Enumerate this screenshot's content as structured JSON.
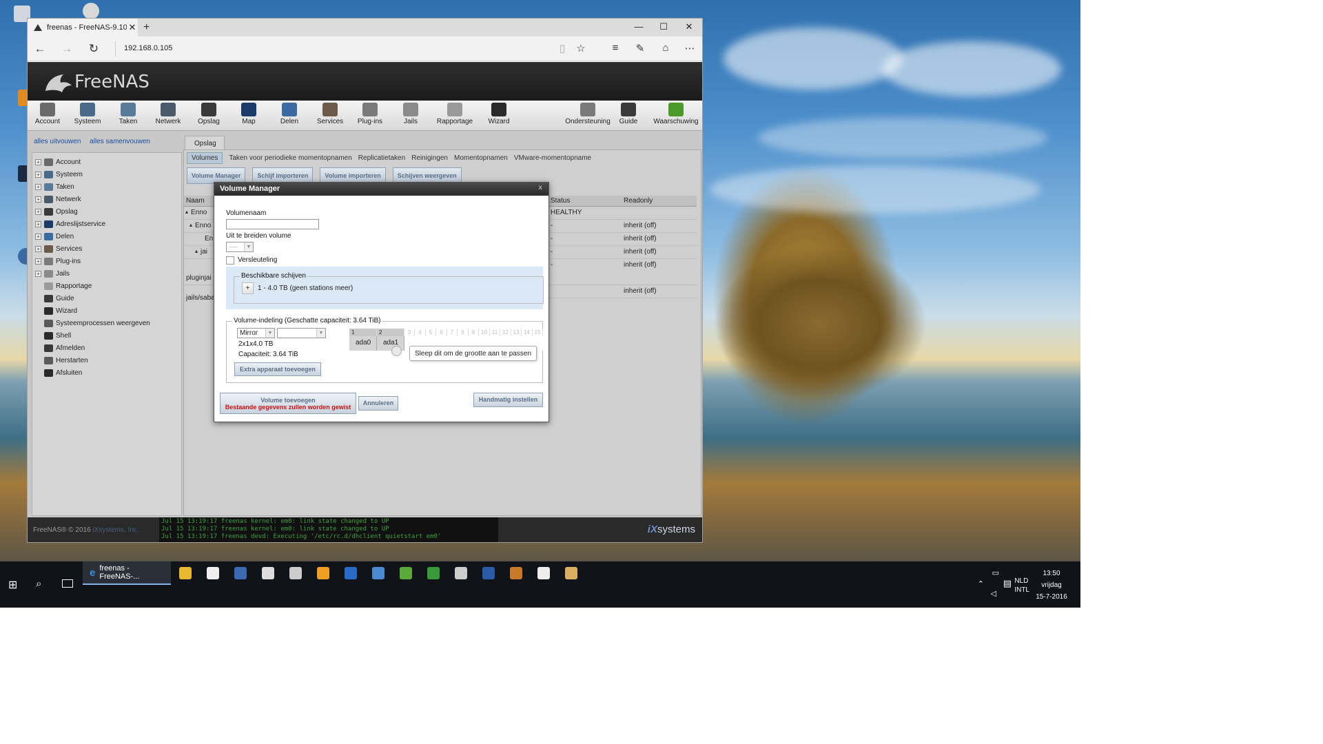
{
  "browser": {
    "tab_title": "freenas - FreeNAS-9.10-",
    "url": "192.168.0.105"
  },
  "freenas": {
    "logo": "FreeNAS",
    "toolbar": [
      {
        "label": "Account",
        "icon": "account-icon",
        "color": "#6a6a6a"
      },
      {
        "label": "Systeem",
        "icon": "system-icon",
        "color": "#4a6a8a"
      },
      {
        "label": "Taken",
        "icon": "tasks-icon",
        "color": "#5a7a9a"
      },
      {
        "label": "Netwerk",
        "icon": "network-icon",
        "color": "#4a5a6a"
      },
      {
        "label": "Opslag",
        "icon": "storage-icon",
        "color": "#3a3a3a"
      },
      {
        "label": "Map",
        "icon": "directory-icon",
        "color": "#1a3a6a"
      },
      {
        "label": "Delen",
        "icon": "sharing-icon",
        "color": "#3a6aa0"
      },
      {
        "label": "Services",
        "icon": "services-icon",
        "color": "#6a5a4a"
      },
      {
        "label": "Plug-ins",
        "icon": "plugins-icon",
        "color": "#7a7a7a"
      },
      {
        "label": "Jails",
        "icon": "jails-icon",
        "color": "#8a8a8a"
      },
      {
        "label": "Rapportage",
        "icon": "reporting-icon",
        "color": "#9a9a9a"
      },
      {
        "label": "Wizard",
        "icon": "wizard-icon",
        "color": "#2a2a2a"
      }
    ],
    "toolbar_right": [
      {
        "label": "Ondersteuning",
        "icon": "support-icon",
        "color": "#7a7a7a"
      },
      {
        "label": "Guide",
        "icon": "guide-icon",
        "color": "#3a3a3a"
      },
      {
        "label": "Waarschuwing",
        "icon": "alert-icon",
        "color": "#4a9a2a"
      }
    ],
    "expand_all": "alles uitvouwen",
    "collapse_all": "alles samenvouwen",
    "tree": [
      {
        "label": "Account",
        "expandable": true,
        "icon": "account-icon",
        "color": "#6a6a6a"
      },
      {
        "label": "Systeem",
        "expandable": true,
        "icon": "system-icon",
        "color": "#4a6a8a"
      },
      {
        "label": "Taken",
        "expandable": true,
        "icon": "tasks-icon",
        "color": "#5a7a9a"
      },
      {
        "label": "Netwerk",
        "expandable": true,
        "icon": "network-icon",
        "color": "#4a5a6a"
      },
      {
        "label": "Opslag",
        "expandable": true,
        "icon": "storage-icon",
        "color": "#3a3a3a"
      },
      {
        "label": "Adreslijstservice",
        "expandable": true,
        "icon": "directory-icon",
        "color": "#1a3a6a"
      },
      {
        "label": "Delen",
        "expandable": true,
        "icon": "sharing-icon",
        "color": "#3a6aa0"
      },
      {
        "label": "Services",
        "expandable": true,
        "icon": "services-icon",
        "color": "#6a5a4a"
      },
      {
        "label": "Plug-ins",
        "expandable": true,
        "icon": "plugins-icon",
        "color": "#7a7a7a"
      },
      {
        "label": "Jails",
        "expandable": true,
        "icon": "jails-icon",
        "color": "#8a8a8a"
      },
      {
        "label": "Rapportage",
        "expandable": false,
        "icon": "reporting-icon",
        "color": "#9a9a9a"
      },
      {
        "label": "Guide",
        "expandable": false,
        "icon": "guide-icon",
        "color": "#3a3a3a"
      },
      {
        "label": "Wizard",
        "expandable": false,
        "icon": "wizard-icon",
        "color": "#2a2a2a"
      },
      {
        "label": "Systeemprocessen weergeven",
        "expandable": false,
        "icon": "processes-icon",
        "color": "#5a5a5a"
      },
      {
        "label": "Shell",
        "expandable": false,
        "icon": "shell-icon",
        "color": "#2a2a2a"
      },
      {
        "label": "Afmelden",
        "expandable": false,
        "icon": "logout-icon",
        "color": "#3a3a3a"
      },
      {
        "label": "Herstarten",
        "expandable": false,
        "icon": "reboot-icon",
        "color": "#5a5a5a"
      },
      {
        "label": "Afsluiten",
        "expandable": false,
        "icon": "shutdown-icon",
        "color": "#2a2a2a"
      }
    ],
    "main_tab": "Opslag",
    "subtabs": [
      "Volumes",
      "Taken voor periodieke momentopnamen",
      "Replicatietaken",
      "Reinigingen",
      "Momentopnamen",
      "VMware-momentopname"
    ],
    "action_buttons": [
      "Volume Manager",
      "Schijf importeren",
      "Volume importeren",
      "Schijven weergeven"
    ],
    "table": {
      "headers": {
        "name": "Naam",
        "status": "Status",
        "readonly": "Readonly"
      },
      "rows": [
        {
          "name": "Enno",
          "status": "HEALTHY",
          "readonly": ""
        },
        {
          "name": "Enno",
          "status": "-",
          "readonly": "inherit (off)"
        },
        {
          "name": "En",
          "status": "-",
          "readonly": "inherit (off)"
        },
        {
          "name": "jai",
          "status": "-",
          "readonly": "inherit (off)"
        },
        {
          "name": "pluginjai",
          "status": "-",
          "readonly": "inherit (off)"
        },
        {
          "name": "jails/saba",
          "status": "",
          "readonly": "inherit (off)"
        }
      ]
    },
    "footer_copy": "FreeNAS® © 2016",
    "footer_company": "iXsystems, Inc.",
    "console_lines": [
      "Jul 15 13:19:17 freenas kernel: em0: link state changed to UP",
      "Jul 15 13:19:17 freenas kernel: em0: link state changed to UP",
      "Jul 15 13:19:17 freenas devd: Executing '/etc/rc.d/dhclient quietstart em0'"
    ],
    "ix_logo_ix": "iX",
    "ix_logo_systems": "systems"
  },
  "modal": {
    "title": "Volume Manager",
    "close": "x",
    "volume_name_label": "Volumenaam",
    "volume_name_value": "",
    "extend_label": "Uit te breiden volume",
    "extend_value": "-----",
    "encryption_label": "Versleuteling",
    "available_disks_legend": "Beschikbare schijven",
    "add_disk_btn": "+",
    "available_disk": "1 - 4.0 TB (geen stations meer)",
    "layout_legend": "Volume-indeling (Geschatte capaciteit: 3.64 TiB)",
    "layout_type": "Mirror",
    "layout_type2": "",
    "layout_desc": "2x1x4.0 TB",
    "capacity": "Capaciteit: 3.64 TiB",
    "extra_device_btn": "Extra apparaat toevoegen",
    "grid_numbers": [
      "1",
      "2",
      "3",
      "4",
      "5",
      "6",
      "7",
      "8",
      "9",
      "10",
      "11",
      "12",
      "13",
      "14",
      "15"
    ],
    "grid_disks": [
      "ada0",
      "ada1"
    ],
    "drag_tooltip": "Sleep dit om de grootte aan te passen",
    "add_volume_btn": "Volume toevoegen",
    "add_volume_warning": "Bestaande gegevens zullen worden gewist",
    "cancel_btn": "Annuleren",
    "manual_btn": "Handmatig instellen"
  },
  "taskbar": {
    "active_task": "freenas - FreeNAS-...",
    "lang1": "NLD",
    "lang2": "INTL",
    "time": "13:50",
    "day": "vrijdag",
    "date": "15-7-2016"
  }
}
